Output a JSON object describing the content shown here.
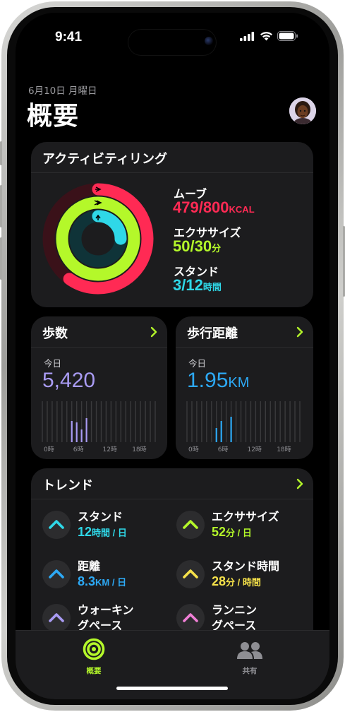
{
  "status_bar": {
    "time": "9:41"
  },
  "header": {
    "date": "6月10日 月曜日",
    "title": "概要"
  },
  "activity": {
    "title": "アクティビティリング",
    "move": {
      "label": "ムーブ",
      "value": "479/800",
      "unit": "KCAL",
      "color": "#ff2a54",
      "progress": 0.599
    },
    "exercise": {
      "label": "エクササイズ",
      "value": "50/30",
      "unit": "分",
      "color": "#b4f82a",
      "progress": 1.667
    },
    "stand": {
      "label": "スタンド",
      "value": "3/12",
      "unit": "時間",
      "color": "#2fd8e8",
      "progress": 0.25
    }
  },
  "steps": {
    "title": "歩数",
    "today_label": "今日",
    "value": "5,420",
    "color": "#a99bf3",
    "axis_labels": [
      "0時",
      "6時",
      "12時",
      "18時"
    ]
  },
  "distance": {
    "title": "歩行距離",
    "today_label": "今日",
    "value": "1.95",
    "unit": "KM",
    "color": "#2da9f5",
    "axis_labels": [
      "0時",
      "6時",
      "12時",
      "18時"
    ]
  },
  "trends": {
    "title": "トレンド",
    "items": [
      {
        "name": "スタンド",
        "value": "12",
        "unit": "時間 / 日",
        "color": "#2fd8e8",
        "icon": "chevron-up-icon"
      },
      {
        "name": "エクササイズ",
        "value": "52",
        "unit": "分 / 日",
        "color": "#b4f82a",
        "icon": "chevron-up-icon"
      },
      {
        "name": "距離",
        "value": "8.3",
        "unit": "KM / 日",
        "color": "#2da9f5",
        "icon": "chevron-up-icon"
      },
      {
        "name": "スタンド時間",
        "value": "28",
        "unit": "分 / 時間",
        "color": "#f5e14a",
        "icon": "chevron-up-icon"
      },
      {
        "name": "ウォーキン\nグペース",
        "value": "",
        "unit": "",
        "color": "#a99bf3",
        "icon": "chevron-up-icon"
      },
      {
        "name": "ランニン\nグペース",
        "value": "",
        "unit": "",
        "color": "#f07fd6",
        "icon": "chevron-up-icon"
      }
    ]
  },
  "tabbar": {
    "summary": {
      "label": "概要",
      "color": "#b4f82a",
      "icon": "activity-rings-icon"
    },
    "sharing": {
      "label": "共有",
      "color": "#8e8e93",
      "icon": "people-icon"
    }
  }
}
